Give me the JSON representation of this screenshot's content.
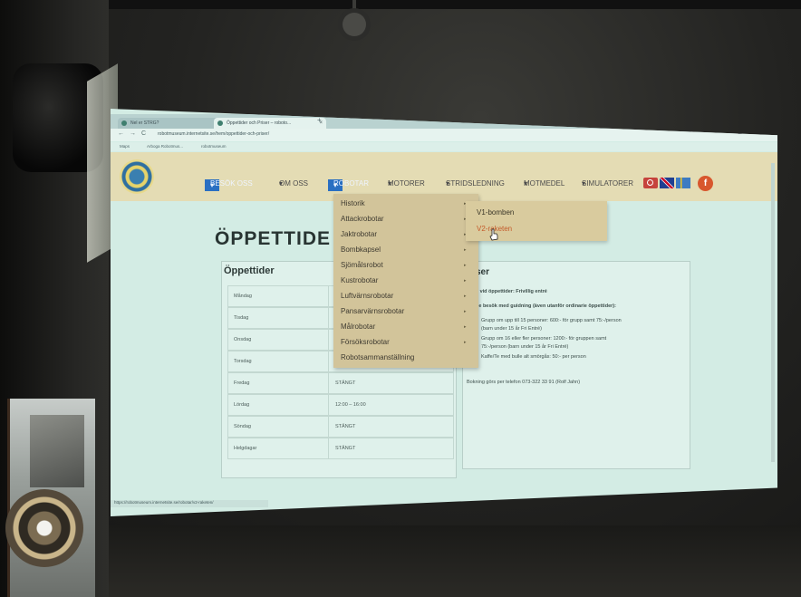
{
  "browser": {
    "tabs": [
      {
        "label": "Nel er STRG?"
      },
      {
        "label": "Öppettider och Priser – roboto..."
      }
    ],
    "url": "robotmuseum.internetsite.se/hem/oppettider-och-priser/",
    "bookmarks": [
      "Maps",
      "Arboga Robotmus...",
      "robotmuseum"
    ],
    "status_url": "https://robotmuseum.internetsite.se/robotar/v2-raketen/"
  },
  "site": {
    "menu": {
      "besok": "BESÖK OSS",
      "om": "OM OSS",
      "robotar": "ROBOTAR",
      "motorer": "MOTORER",
      "strid": "STRIDSLEDNING",
      "motmedel": "MOTMEDEL",
      "simulatorer": "SIMULATORER"
    },
    "dropdown": [
      "Historik",
      "Attackrobotar",
      "Jaktrobotar",
      "Bombkapsel",
      "Sjömålsrobot",
      "Kustrobotar",
      "Luftvärnsrobotar",
      "Pansarvärnsrobotar",
      "Målrobotar",
      "Försöksrobotar",
      "Robotsammanställning"
    ],
    "submenu": [
      "V1-bomben",
      "V2-raketen"
    ],
    "page_title": "ÖPPETTIDE",
    "hours_title": "Öppettider",
    "hours": [
      {
        "day": "Måndag",
        "time": ""
      },
      {
        "day": "Tisdag",
        "time": ""
      },
      {
        "day": "Onsdag",
        "time": ""
      },
      {
        "day": "Torsdag",
        "time": ""
      },
      {
        "day": "Fredag",
        "time": "STÄNGT"
      },
      {
        "day": "Lördag",
        "time": "12:00 – 16:00"
      },
      {
        "day": "Söndag",
        "time": "STÄNGT"
      },
      {
        "day": "Helgdagar",
        "time": "STÄNGT"
      }
    ],
    "prices_title": "ser",
    "prices": {
      "line1": "k vid öppettider: Frivillig entré",
      "line2": "de besök med guidning (även utanför ordinarie öppettider):",
      "line3": "Grupp om upp till 15 personer: 600:- för grupp samt 75:-/person",
      "line4": "(barn under 15 år Fri Entré)",
      "line5": "Grupp om 16 eller fler personer: 1200:- för gruppen samt",
      "line6": "75:-/person (barn under 15 år Fri Entré)",
      "line7": "Kaffe/Te med bulle alt smörgås: 50:- per person",
      "booking": "Bokning görs per telefon 073-322 33 91 (Rolf Jahn)"
    }
  }
}
